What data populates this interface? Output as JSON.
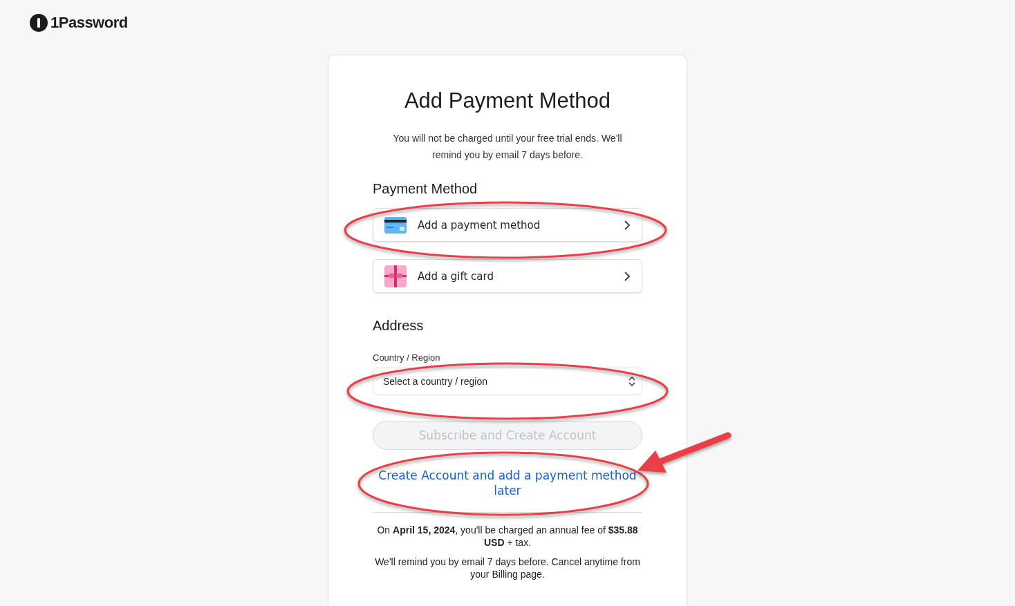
{
  "brand": {
    "name": "1Password"
  },
  "title": "Add Payment Method",
  "subtitle": "You will not be charged until your free trial ends. We'll remind you by email 7 days before.",
  "payment_section": {
    "heading": "Payment Method",
    "options": [
      {
        "kind": "card",
        "label": "Add a payment method"
      },
      {
        "kind": "gift",
        "label": "Add a gift card"
      }
    ]
  },
  "address_section": {
    "heading": "Address",
    "field_label": "Country / Region",
    "select": {
      "placeholder": "Select a country / region"
    }
  },
  "submit_button": {
    "label": "Subscribe and Create Account",
    "disabled": true
  },
  "later_link": "Create Account and add a payment method later",
  "notes": [
    "On **April 15, 2024**, you'll be charged an annual fee of **$35.88 USD** + tax.",
    "We'll remind you by email 7 days before. Cancel anytime from your Billing page."
  ]
}
